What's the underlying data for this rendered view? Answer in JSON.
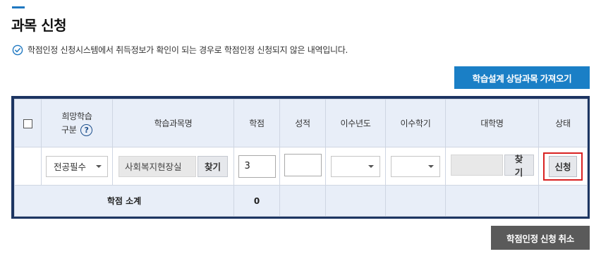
{
  "page": {
    "title": "과목 신청",
    "notice": "학점인정 신청시스템에서 취득정보가 확인이 되는 경우로 학점인정 신청되지 않은 내역입니다.",
    "import_button": "학습설계 상담과목 가져오기",
    "cancel_button": "학점인정 신청 취소"
  },
  "colors": {
    "accent": "#1f78c1",
    "primary_button": "#1a7fc6",
    "table_border": "#1c3562",
    "header_bg": "#e8eef8",
    "highlight_border": "#d92222",
    "cancel_button": "#5a5a5a"
  },
  "table": {
    "headers": {
      "desired_type_line1": "희망학습",
      "desired_type_line2": "구분",
      "help_symbol": "?",
      "course_name": "학습과목명",
      "credits": "학점",
      "grade": "성적",
      "completion_year": "이수년도",
      "completion_semester": "이수학기",
      "university": "대학명",
      "status": "상태"
    },
    "row": {
      "desired_type": "전공필수",
      "course_name": "사회복지현장실",
      "find_label": "찾기",
      "credits": "3",
      "grade": "",
      "completion_year": "",
      "completion_semester": "",
      "university": "",
      "university_find_label": "찾기",
      "apply_label": "신청"
    },
    "summary": {
      "label": "학점 소계",
      "value": "0"
    }
  },
  "icons": {
    "notice_icon": "check-circle-icon",
    "help_icon": "question-circle-icon",
    "dropdown_icon": "caret-down-icon"
  }
}
